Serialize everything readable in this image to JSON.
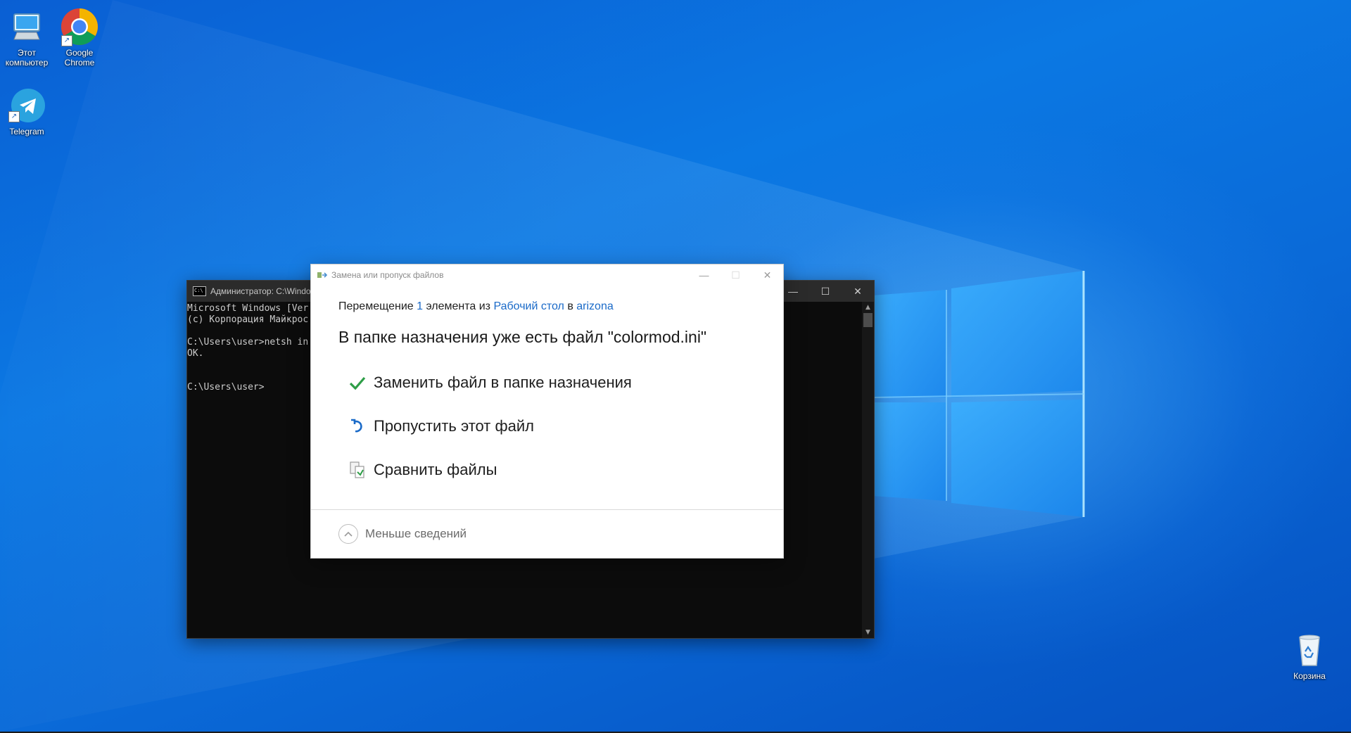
{
  "desktop": {
    "icons": [
      {
        "label": "Этот компьютер",
        "icon": "this-pc-icon"
      },
      {
        "label": "Google Chrome",
        "icon": "chrome-icon"
      },
      {
        "label": "Telegram",
        "icon": "telegram-icon"
      },
      {
        "label": "Корзина",
        "icon": "recycle-bin-icon"
      }
    ]
  },
  "console": {
    "title": "Администратор: C:\\Windo",
    "lines": [
      "Microsoft Windows [Ver",
      "(c) Корпорация Майкрос",
      "",
      "C:\\Users\\user>netsh in",
      "OK.",
      "",
      "",
      "C:\\Users\\user>"
    ],
    "controls": {
      "minimize": "—",
      "maximize": "☐",
      "close": "✕"
    }
  },
  "dialog": {
    "title": "Замена или пропуск файлов",
    "summary": {
      "prefix": "Перемещение ",
      "count": "1",
      "middle": " элемента из ",
      "source": "Рабочий стол",
      "connector": " в ",
      "destination": "arizona"
    },
    "heading": "В папке назначения уже есть файл \"colormod.ini\"",
    "options": [
      {
        "label": "Заменить файл в папке назначения",
        "icon": "checkmark-icon"
      },
      {
        "label": "Пропустить этот файл",
        "icon": "undo-arrow-icon"
      },
      {
        "label": "Сравнить файлы",
        "icon": "compare-files-icon"
      }
    ],
    "details_label": "Меньше сведений",
    "controls": {
      "minimize": "—",
      "maximize": "☐",
      "close": "✕"
    }
  },
  "colors": {
    "link": "#1a6ac8",
    "check": "#2e9e47",
    "accent_blue": "#1a6ac8"
  }
}
